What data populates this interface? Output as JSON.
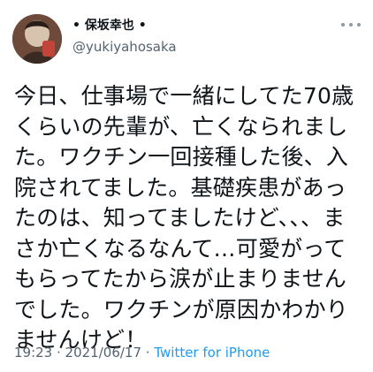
{
  "author": {
    "display_name": "• 保坂幸也 •",
    "handle": "@yukiyahosaka",
    "avatar_icon": "profile-photo"
  },
  "tweet": {
    "text": "今日、仕事場で一緒にしてた70歳くらいの先輩が、亡くなられました。ワクチン一回接種した後、入院されてました。基礎疾患があったのは、知ってましたけど、、、まさか亡くなるなんて…可愛がってもらってたから涙が止まりませんでした。ワクチンが原因かわかりませんけど！"
  },
  "meta": {
    "time": "19:23",
    "separator1": " · ",
    "date": "2021/06/17",
    "separator2": " · ",
    "source": "Twitter for iPhone"
  },
  "icons": {
    "more": "more-dots-icon"
  },
  "colors": {
    "text": "#0f1419",
    "secondary": "#536471",
    "link": "#1d9bf0",
    "background": "#ffffff"
  }
}
